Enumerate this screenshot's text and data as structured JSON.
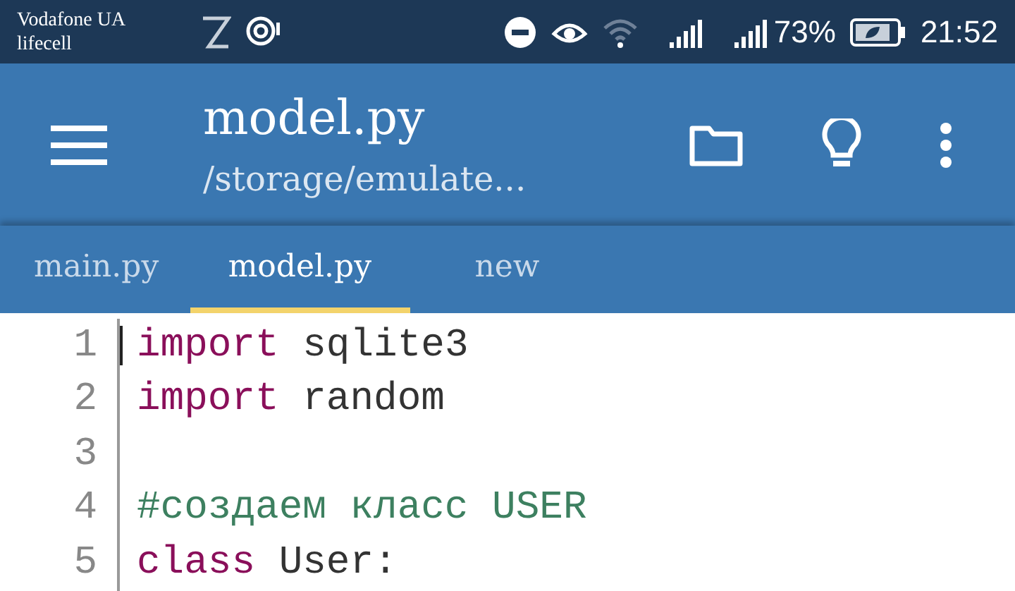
{
  "status_bar": {
    "carriers": [
      "Vodafone UA",
      "lifecell"
    ],
    "battery_percent": "73%",
    "time": "21:52"
  },
  "toolbar": {
    "title": "model.py",
    "subtitle": "/storage/emulate..."
  },
  "tabs": [
    {
      "label": "main.py",
      "selected": false
    },
    {
      "label": "model.py",
      "selected": true
    },
    {
      "label": "new",
      "selected": false
    }
  ],
  "editor": {
    "lines": [
      {
        "number": "1",
        "tokens": [
          {
            "kind": "keyword",
            "text": "import"
          },
          {
            "kind": "plain",
            "text": " sqlite3"
          }
        ]
      },
      {
        "number": "2",
        "tokens": [
          {
            "kind": "keyword",
            "text": "import"
          },
          {
            "kind": "plain",
            "text": " random"
          }
        ]
      },
      {
        "number": "3"
      },
      {
        "number": "4",
        "tokens": [
          {
            "kind": "comment",
            "text": "#создаем класс USER"
          }
        ]
      },
      {
        "number": "5",
        "tokens": [
          {
            "kind": "keyword",
            "text": "class"
          },
          {
            "kind": "plain",
            "text": " User:"
          }
        ]
      }
    ]
  }
}
